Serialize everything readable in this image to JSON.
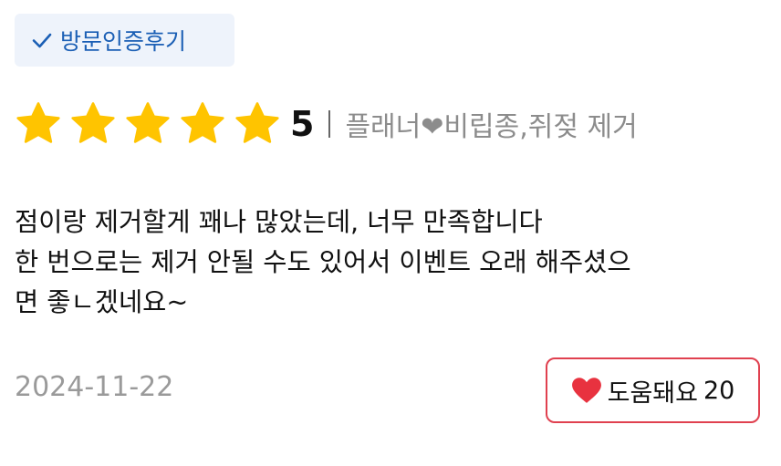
{
  "badge": {
    "label": "방문인증후기",
    "icon": "check-icon"
  },
  "rating": {
    "stars": 5,
    "max_stars": 5,
    "score_text": "5",
    "star_color": "#FFC400",
    "option_before_heart": "플래너",
    "option_after_heart": "비립종,쥐젖 제거"
  },
  "review": {
    "lines": [
      "점이랑 제거할게 꽤나 많았는데, 너무 만족합니다",
      "한 번으로는 제거 안될 수도 있어서 이벤트 오래 해주셨으",
      "면 좋ㄴ겠네요~"
    ]
  },
  "date": "2024-11-22",
  "helpful_button": {
    "label": "도움돼요",
    "count": "20",
    "accent": "#E0404F"
  }
}
